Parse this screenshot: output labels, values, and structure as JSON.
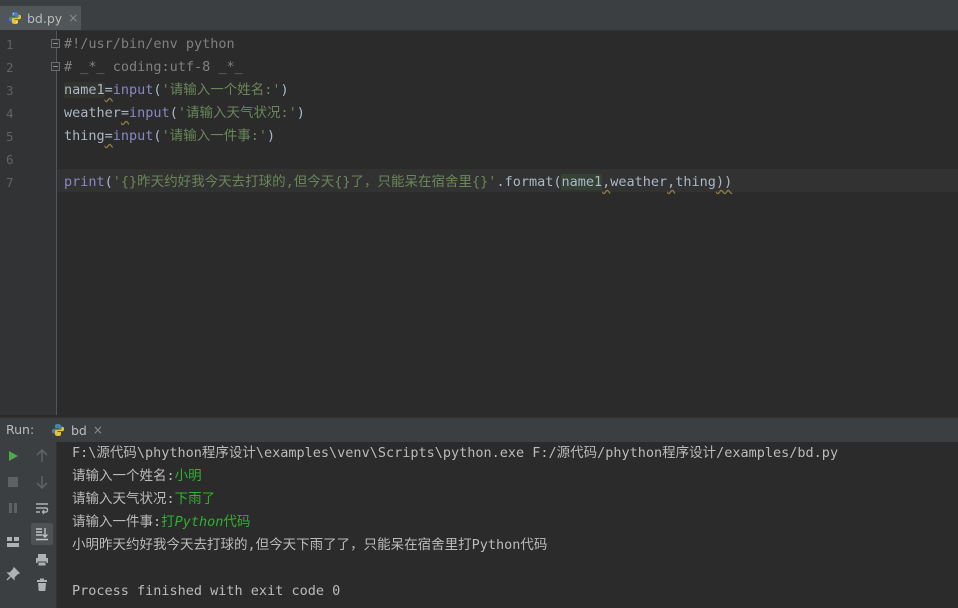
{
  "editor_tab": {
    "filename": "bd.py",
    "close": "×"
  },
  "editor": {
    "line_numbers": [
      "1",
      "2",
      "3",
      "4",
      "5",
      "6",
      "7"
    ],
    "lines": {
      "l1": "#!/usr/bin/env python",
      "l2": "# _*_ coding:utf-8 _*_",
      "l3": {
        "var": "name1",
        "op": "=",
        "fn": "input",
        "open": "(",
        "str": "'请输入一个姓名:'",
        "close": ")"
      },
      "l4": {
        "var": "weather",
        "op": "=",
        "fn": "input",
        "open": "(",
        "str": "'请输入天气状况:'",
        "close": ")"
      },
      "l5": {
        "var": "thing",
        "op": "=",
        "fn": "input",
        "open": "(",
        "str": "'请输入一件事:'",
        "close": ")"
      },
      "l7": {
        "fn": "print",
        "open": "(",
        "str": "'{}昨天约好我今天去打球的,但今天{}了，只能呆在宿舍里{}'",
        "rest1": ".format(",
        "a1": "name1",
        "c1": ",",
        "a2": "weather",
        "c2": ",",
        "a3": "thing",
        "close": "))"
      }
    }
  },
  "run_panel": {
    "label": "Run:",
    "tab_name": "bd",
    "close": "×",
    "toolbar_icons": [
      "play-icon",
      "up-arrow-icon",
      "stop-icon",
      "down-arrow-icon",
      "pause-icon",
      "soft-wrap-icon",
      "layout-icon",
      "scroll-to-end-icon",
      "print-icon",
      "pin-icon",
      "trash-icon"
    ]
  },
  "console": {
    "command": "F:\\源代码\\phython程序设计\\examples\\venv\\Scripts\\python.exe F:/源代码/phython程序设计/examples/bd.py",
    "prompt1": "请输入一个姓名:",
    "input1": "小明",
    "prompt2": "请输入天气状况:",
    "input2": "下雨了",
    "prompt3": "请输入一件事:",
    "input3a": "打",
    "input3b": "Python",
    "input3c": "代码",
    "output": "小明昨天约好我今天去打球的,但今天下雨了了，只能呆在宿舍里打Python代码",
    "exit": "Process finished with exit code 0"
  },
  "colors": {
    "background": "#2b2b2b",
    "panel": "#3c3f41",
    "string": "#6a8759",
    "builtin": "#8888c6",
    "comment": "#808080",
    "input": "#30b030",
    "run": "#4ca94c"
  }
}
